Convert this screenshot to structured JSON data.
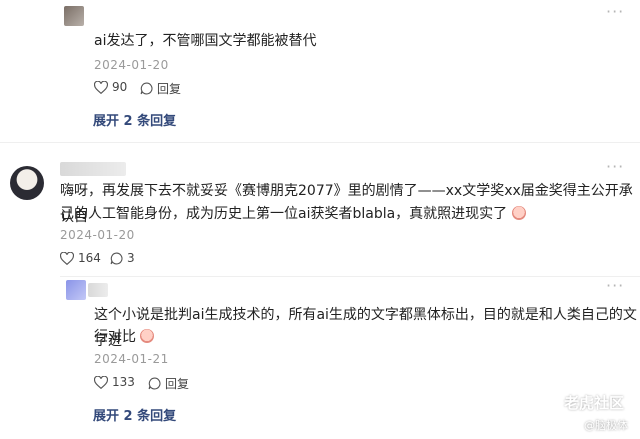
{
  "comment1": {
    "text": "ai发达了，不管哪国文学都能被替代",
    "date": "2024-01-20",
    "likes": "90",
    "reply_label": "回复",
    "expand_label": "展开 2 条回复"
  },
  "comment2": {
    "text_line1": "嗨呀，再发展下去不就妥妥《赛博朋克2077》里的剧情了——xx文学奖xx届金奖得主公开承认自",
    "text_line2": "己的人工智能身份，成为历史上第一位ai获奖者blabla，真就照进现实了",
    "date": "2024-01-20",
    "likes": "164",
    "replies": "3"
  },
  "reply1": {
    "text_line1": "这个小说是批判ai生成技术的，所有ai生成的文字都黑体标出，目的就是和人类自己的文字进",
    "text_line2": "行对比",
    "date": "2024-01-21",
    "likes": "133",
    "reply_label": "回复",
    "expand_label": "展开 2 条回复"
  },
  "more_glyph": "···",
  "watermark": {
    "brand": "老虎社区",
    "sub": "@脑极体"
  },
  "colors": {
    "expand": "#33497a",
    "date": "#9a9a9a"
  }
}
